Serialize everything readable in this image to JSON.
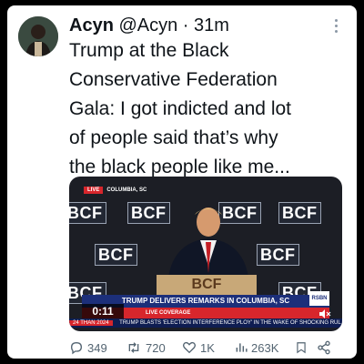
{
  "tweet": {
    "author_name": "Acyn",
    "handle": "@Acyn",
    "separator": "·",
    "time": "31m",
    "text": "Trump at the Black\nConservative Federation\nGala: I got indicted and lot\nof people said that’s why\nthe black people like me..."
  },
  "video": {
    "live_label": "LIVE",
    "location": "COLUMBIA, SC",
    "logo_text": "BCF",
    "podium_text": "BCF",
    "headline": "TRUMP DELIVERS REMARKS IN COLUMBIA, SC",
    "sub_label": "LIVE COVERAGE",
    "timer": "0:11",
    "ticker_date": "24 THAN 2024",
    "ticker_text": "TRUMP BLASTS 'ELECTION INTERFERENCE PLOY' IN THE WAKE OF SHOCKING RUL",
    "channel": "RSBN"
  },
  "actions": {
    "replies": "349",
    "reposts": "720",
    "likes": "1K",
    "views": "263K"
  },
  "icons": {
    "reply": "reply-icon",
    "repost": "repost-icon",
    "like": "like-icon",
    "views": "views-icon",
    "bookmark": "bookmark-icon",
    "share": "share-icon",
    "more": "more-icon"
  },
  "colors": {
    "background": "#000000",
    "card": "#ffffff",
    "text": "#0f1419",
    "secondary": "#536471",
    "live_red": "#d7262c",
    "banner_blue": "#1c2f7a"
  }
}
